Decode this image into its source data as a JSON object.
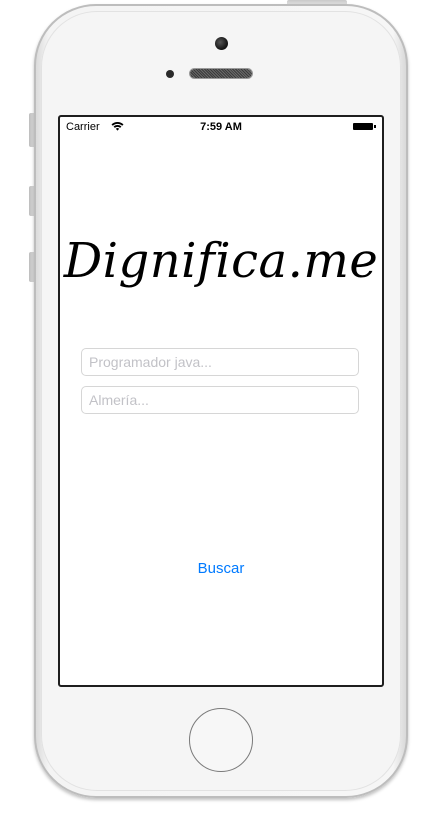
{
  "status_bar": {
    "carrier": "Carrier",
    "time": "7:59 AM",
    "wifi_icon": "wifi-icon",
    "battery_icon": "battery-icon"
  },
  "app": {
    "logo": "Dignifica.me"
  },
  "search": {
    "job_placeholder": "Programador java...",
    "job_value": "",
    "location_placeholder": "Almería...",
    "location_value": "",
    "button_label": "Buscar"
  },
  "colors": {
    "accent": "#007aff",
    "placeholder": "#c2c2c7",
    "field_border": "#d6d6d6"
  }
}
